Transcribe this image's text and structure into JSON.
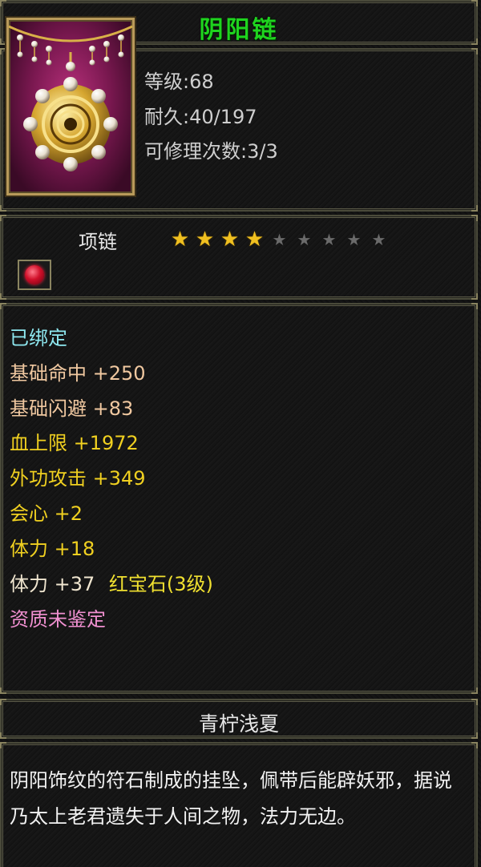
{
  "item": {
    "name": "阴阳链",
    "level": "等级:68",
    "durability": "耐久:40/197",
    "repair_count": "可修理次数:3/3",
    "type": "项链",
    "stars": {
      "filled": 4,
      "total": 9
    },
    "icon": "necklace-icon",
    "gem_icon": "red-gem-icon"
  },
  "attributes": {
    "bound": "已绑定",
    "base": [
      "基础命中 +250",
      "基础闪避 +83"
    ],
    "extra": [
      "血上限 +1972",
      "外功攻击 +349",
      "会心 +2",
      "体力 +18"
    ],
    "gem_line": {
      "stat": "体力 +37",
      "gem": "红宝石(3级)"
    },
    "quality": "资质未鉴定"
  },
  "owner": "青柠浅夏",
  "description": "阴阳饰纹的符石制成的挂坠，佩带后能辟妖邪，据说乃太上老君遗失于人间之物，法力无边。",
  "colors": {
    "title": "#1fd41f",
    "bound": "#8ee8f0",
    "base": "#f0c8a0",
    "extra": "#f0d020",
    "quality": "#f090d0",
    "border": "#8a8460"
  }
}
